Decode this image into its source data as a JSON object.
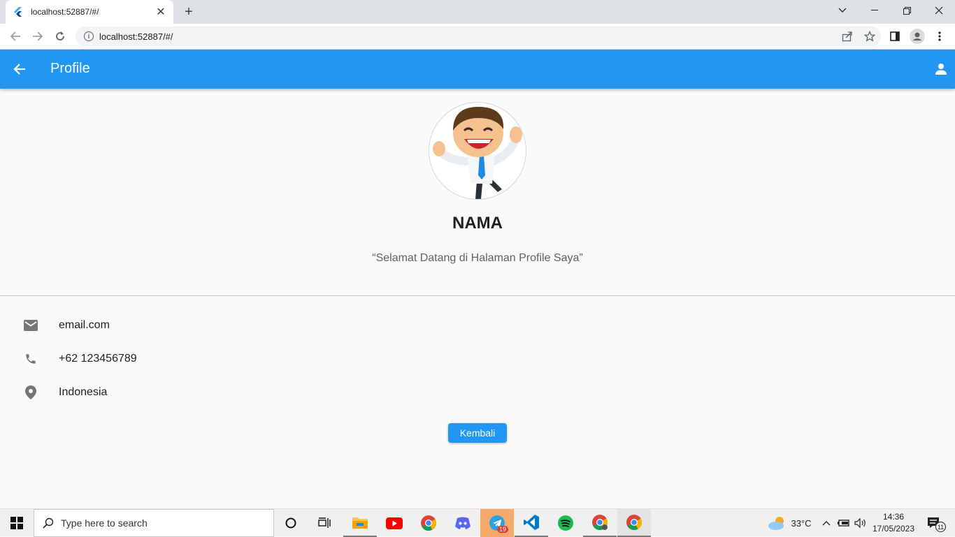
{
  "browser": {
    "tab_title": "localhost:52887/#/",
    "url": "localhost:52887/#/"
  },
  "app": {
    "title": "Profile",
    "accent": "#2196f3"
  },
  "profile": {
    "name": "NAMA",
    "quote": "“Selamat Datang di Halaman Profile Saya”",
    "contacts": [
      {
        "icon": "mail-icon",
        "text": "email.com"
      },
      {
        "icon": "phone-icon",
        "text": "+62 123456789"
      },
      {
        "icon": "location-icon",
        "text": "Indonesia"
      }
    ],
    "button_label": "Kembali"
  },
  "taskbar": {
    "search_placeholder": "Type here to search",
    "weather": "33°C",
    "time": "14:36",
    "date": "17/05/2023",
    "telegram_badge": "19",
    "notification_count": "11"
  }
}
